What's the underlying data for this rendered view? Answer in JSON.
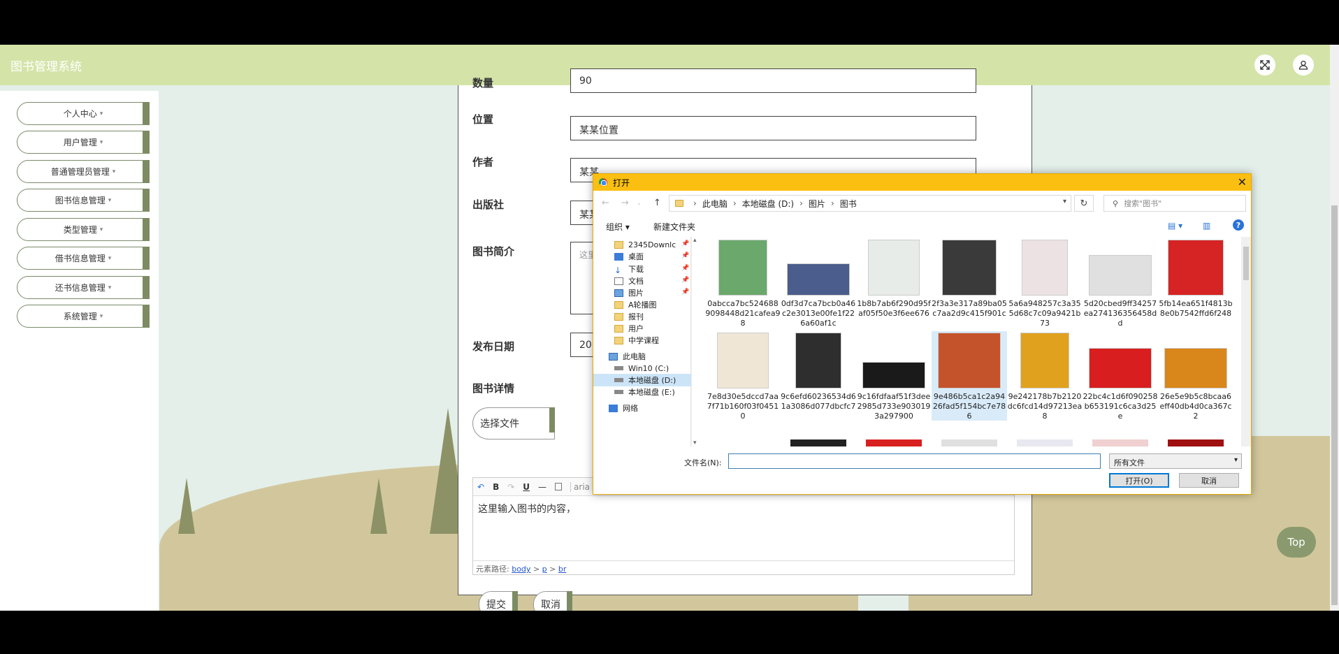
{
  "app": {
    "title": "图书管理系统"
  },
  "sidebar": {
    "items": [
      {
        "label": "个人中心"
      },
      {
        "label": "用户管理"
      },
      {
        "label": "普通管理员管理"
      },
      {
        "label": "图书信息管理"
      },
      {
        "label": "类型管理"
      },
      {
        "label": "借书信息管理"
      },
      {
        "label": "还书信息管理"
      },
      {
        "label": "系统管理"
      }
    ],
    "caret": "▾"
  },
  "form": {
    "quantity": {
      "label": "数量",
      "value": "90"
    },
    "location": {
      "label": "位置",
      "value": "某某位置"
    },
    "author": {
      "label": "作者",
      "value": "某某"
    },
    "publisher": {
      "label": "出版社",
      "value": "某某"
    },
    "intro": {
      "label": "图书简介",
      "value": "这里"
    },
    "publish_date": {
      "label": "发布日期",
      "value": "20"
    },
    "details": {
      "label": "图书详情"
    },
    "choose_file": "选择文件",
    "editor_content": "这里输入图书的内容，",
    "editor_font": "aria",
    "element_path": {
      "label": "元素路径:",
      "body": "body",
      "p": "p",
      "br": "br",
      "gt": ">"
    },
    "submit": "提交",
    "cancel": "取消"
  },
  "top_button": "Top",
  "dialog": {
    "title": "打开",
    "close": "✕",
    "breadcrumb": [
      "此电脑",
      "本地磁盘 (D:)",
      "图片",
      "图书"
    ],
    "breadcrumb_sep": "›",
    "search_placeholder": "搜索\"图书\"",
    "organize": "组织 ▾",
    "new_folder": "新建文件夹",
    "nav_items": [
      {
        "label": "2345Downlc",
        "icon": "folder",
        "pinned": true
      },
      {
        "label": "桌面",
        "icon": "desktop",
        "pinned": true
      },
      {
        "label": "下载",
        "icon": "download",
        "pinned": true
      },
      {
        "label": "文档",
        "icon": "document",
        "pinned": true
      },
      {
        "label": "图片",
        "icon": "pictures",
        "pinned": true
      },
      {
        "label": "A轮播图",
        "icon": "folder",
        "pinned": false
      },
      {
        "label": "报刊",
        "icon": "folder",
        "pinned": false
      },
      {
        "label": "用户",
        "icon": "folder",
        "pinned": false
      },
      {
        "label": "中学课程",
        "icon": "folder",
        "pinned": false
      },
      {
        "label": "此电脑",
        "icon": "computer",
        "pinned": false
      },
      {
        "label": "Win10 (C:)",
        "icon": "drive",
        "pinned": false
      },
      {
        "label": "本地磁盘 (D:)",
        "icon": "drive",
        "pinned": false,
        "selected": true
      },
      {
        "label": "本地磁盘 (E:)",
        "icon": "drive",
        "pinned": false
      },
      {
        "label": "网络",
        "icon": "network",
        "pinned": false
      }
    ],
    "files": [
      {
        "name": "0abcca7bc5246889098448d21cafea98",
        "color": "#6aa86b"
      },
      {
        "name": "0df3d7ca7bcb0a46c2e3013e00fe1f226a60af1c",
        "color": "#4a5d8c"
      },
      {
        "name": "1b8b7ab6f290d95faf05f50e3f6ee676",
        "color": "#e8ece9"
      },
      {
        "name": "2f3a3e317a89ba05c7aa2d9c415f901c",
        "color": "#3a3a3a"
      },
      {
        "name": "5a6a948257c3a355d68c7c09a9421b73",
        "color": "#ece2e4"
      },
      {
        "name": "5d20cbed9ff34257ea274136356458dd",
        "color": "#e0e0e0"
      },
      {
        "name": "5fb14ea651f4813b8e0b7542ffd6f248",
        "color": "#d62424"
      },
      {
        "name": "7e8d30e5dccd7aa7f71b160f03f04510",
        "color": "#efe6d6"
      },
      {
        "name": "9c6efd60236534d61a3086d077dbcfc7",
        "color": "#2e2e2e"
      },
      {
        "name": "9c16fdfaaf51f3dee2985d733e9030193a297900",
        "color": "#1a1a1a"
      },
      {
        "name": "9e486b5ca1c2a9426fad5f154bc7e786",
        "color": "#c4532c",
        "selected": true
      },
      {
        "name": "9e242178b7b2120dc6fcd14d97213ea8",
        "color": "#e0a21e"
      },
      {
        "name": "22bc4c1d6f090258b653191c6ca3d25e",
        "color": "#d81e1e"
      },
      {
        "name": "26e5e9b5c8bcaa6eff40db4d0ca367c2",
        "color": "#d9861a"
      }
    ],
    "filename_label": "文件名(N):",
    "filename_value": "",
    "filter": "所有文件",
    "open_button": "打开(O)",
    "cancel_button": "取消"
  }
}
